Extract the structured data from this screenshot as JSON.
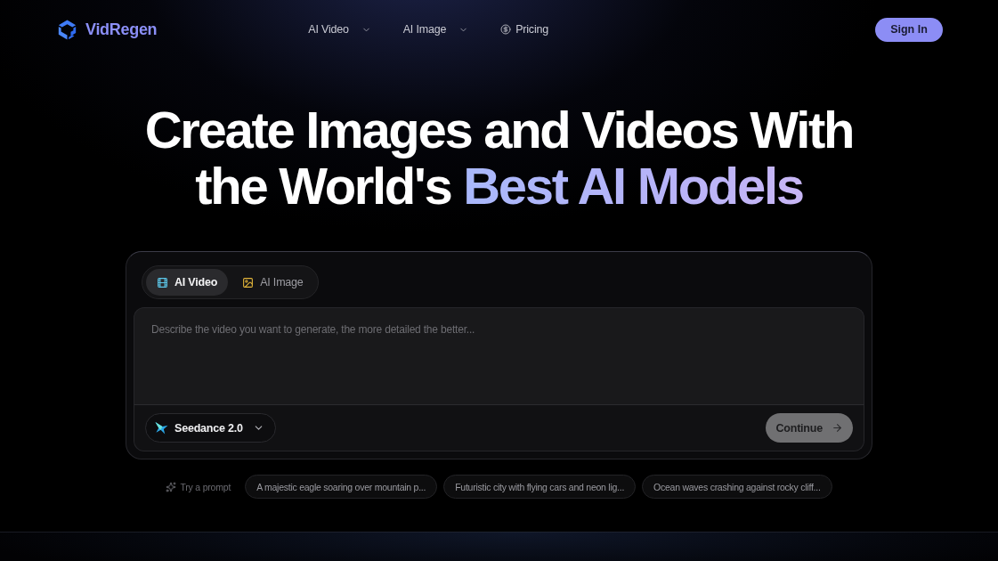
{
  "nav": {
    "logo": "VidRegen",
    "items": [
      {
        "label": "AI Video",
        "kind": "dropdown"
      },
      {
        "label": "AI Image",
        "kind": "dropdown"
      },
      {
        "label": "Pricing",
        "kind": "link"
      }
    ],
    "sign_in": "Sign In"
  },
  "hero": {
    "line_1": "Create Images and Videos With",
    "line_2": "the World's",
    "highlight": "Best AI Models"
  },
  "generator": {
    "tabs": [
      {
        "label": "AI Video",
        "kind": "video",
        "selected": true
      },
      {
        "label": "AI Image",
        "kind": "image",
        "selected": false
      }
    ],
    "prompt": {
      "placeholder": "Describe the video you want to generate, the more detailed the better..."
    },
    "model": "Seedance 2.0",
    "continue": {
      "label": "Continue",
      "disabled": true
    }
  },
  "suggestions": {
    "label": "Try a prompt",
    "items": [
      "A majestic eagle soaring over mountain p...",
      "Futuristic city with flying cars and neon lig...",
      "Ocean waves crashing against rocky cliff..."
    ]
  }
}
